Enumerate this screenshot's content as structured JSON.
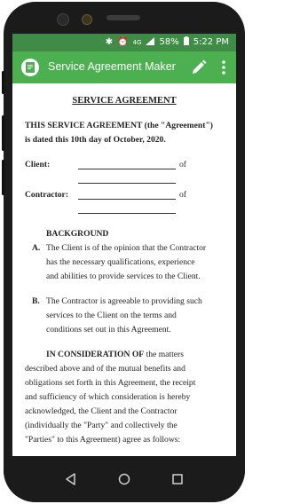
{
  "status": {
    "battery": "58%",
    "time": "5:22 PM",
    "signal": "4G"
  },
  "appbar": {
    "title": "Service Agreement Maker"
  },
  "colors": {
    "status_bar": "#3f8c46",
    "app_bar": "#4caf50"
  },
  "document": {
    "title": "SERVICE AGREEMENT",
    "intro_line1": "THIS SERVICE AGREEMENT (the \"Agreement\")",
    "intro_line2": "is dated this 10th day of October, 2020.",
    "client_label": "Client:",
    "contractor_label": "Contractor:",
    "of_text": "of",
    "background_heading": "BACKGROUND",
    "item_a_letter": "A.",
    "item_a_lines": [
      "The Client is of the opinion that the Contractor",
      "has the necessary qualifications, experience",
      "and abilities to provide services to the Client."
    ],
    "item_b_letter": "B.",
    "item_b_lines": [
      "The Contractor is agreeable to providing such",
      "services to the Client on the terms and",
      "conditions set out in this Agreement."
    ],
    "consideration_bold": "IN CONSIDERATION OF",
    "consideration_first_rest": " the matters",
    "consideration_lines": [
      "described above and of the mutual benefits and",
      "obligations set forth in this Agreement, the receipt",
      "and sufficiency of which consideration is hereby",
      "acknowledged, the Client and the Contractor",
      "(individually the \"Party\" and collectively the",
      "\"Parties\" to this Agreement) agree as follows:"
    ]
  },
  "icons": {
    "back": "back-icon",
    "home": "home-icon",
    "recents": "recents-icon",
    "edit": "pencil-icon",
    "more": "more-vert-icon"
  }
}
